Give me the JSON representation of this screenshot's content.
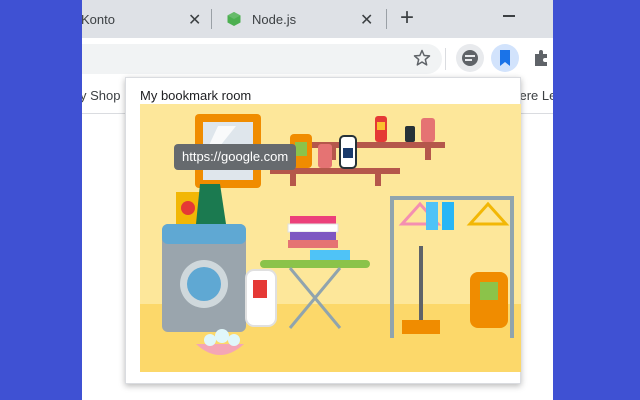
{
  "tabs": [
    {
      "title": "Konto"
    },
    {
      "title": "Node.js"
    }
  ],
  "new_tab_symbol": "+",
  "close_symbol": "✕",
  "bookmarks_bar": {
    "left_item": "y Shop",
    "right_item": "itere Le"
  },
  "popup": {
    "title": "My bookmark room",
    "tooltip": "https://google.com"
  },
  "icons": {
    "tab_favicon": "nodejs-icon",
    "star": "star-icon",
    "ext1": "reading-list-icon",
    "ext2": "bookmark-icon",
    "ext3": "puzzle-icon"
  },
  "colors": {
    "background": "#3f51d3",
    "tabstrip": "#dee1e6",
    "scene_wall": "#fde79a",
    "accent_blue": "#1a73e8"
  }
}
